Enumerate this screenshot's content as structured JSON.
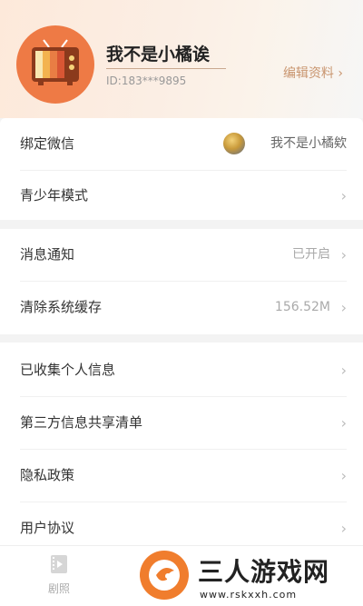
{
  "profile": {
    "nickname": "我不是小橘诶",
    "user_id": "ID:183***9895",
    "edit_label": "编辑资料",
    "chevron": "›"
  },
  "settings": {
    "wechat": {
      "label": "绑定微信",
      "value": "我不是小橘欸"
    },
    "teen_mode": {
      "label": "青少年模式"
    },
    "notifications": {
      "label": "消息通知",
      "value": "已开启"
    },
    "clear_cache": {
      "label": "清除系统缓存",
      "value": "156.52M"
    },
    "personal_info": {
      "label": "已收集个人信息"
    },
    "third_party": {
      "label": "第三方信息共享清单"
    },
    "privacy": {
      "label": "隐私政策"
    },
    "agreement": {
      "label": "用户协议"
    }
  },
  "tabbar": {
    "juzhao": {
      "label": "剧照",
      "icon": "film-icon"
    }
  },
  "watermark": {
    "title": "三人游戏网",
    "url": "www.rskxxh.com"
  },
  "colors": {
    "accent": "#ee7a45",
    "edit_text": "#c9956f",
    "watermark_orange": "#f07d2d"
  }
}
